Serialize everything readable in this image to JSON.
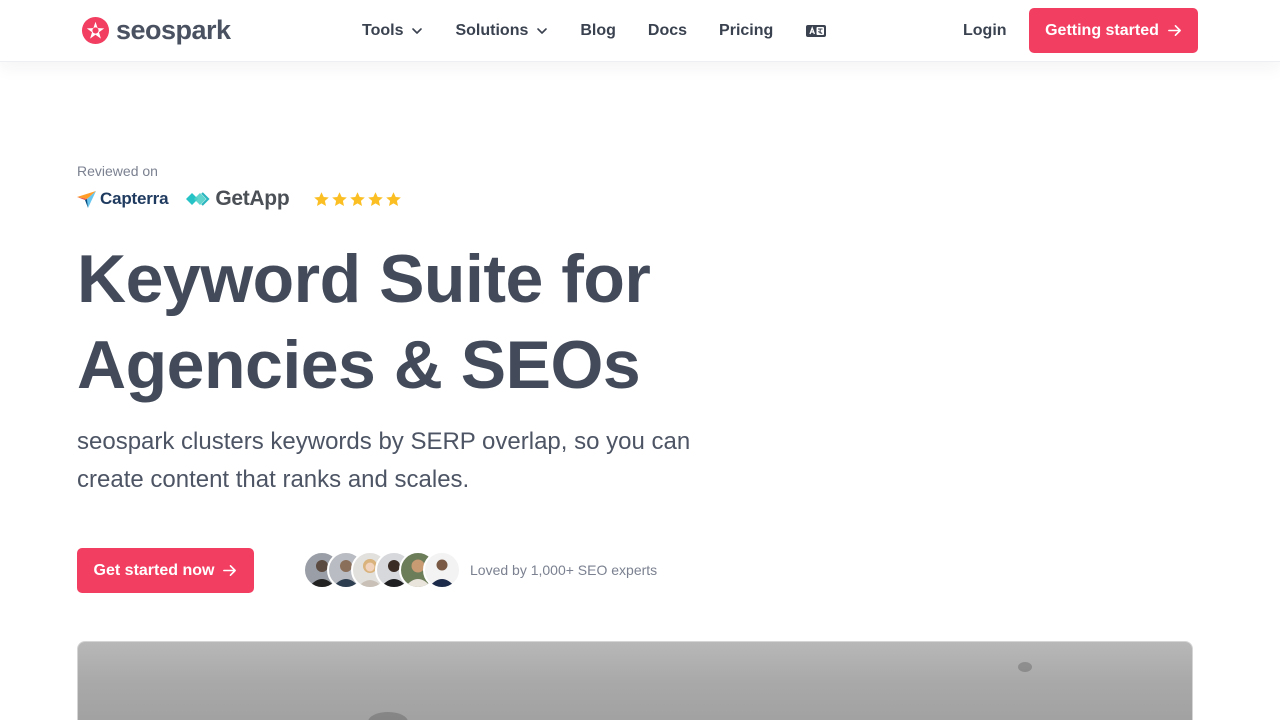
{
  "brand": {
    "name": "seospark",
    "accent": "#f23e61"
  },
  "nav": {
    "items": [
      {
        "label": "Tools",
        "dropdown": true
      },
      {
        "label": "Solutions",
        "dropdown": true
      },
      {
        "label": "Blog",
        "dropdown": false
      },
      {
        "label": "Docs",
        "dropdown": false
      },
      {
        "label": "Pricing",
        "dropdown": false
      }
    ],
    "language_icon": "language-icon",
    "login_label": "Login",
    "cta_label": "Getting started"
  },
  "reviews": {
    "label": "Reviewed on",
    "capterra": "Capterra",
    "getapp": "GetApp",
    "rating": 5,
    "star_color": "#fbbf24"
  },
  "hero": {
    "headline_line1": "Keyword Suite for",
    "headline_line2": "Agencies & SEOs",
    "subtext": "seospark clusters keywords by SERP overlap, so you can create content that ranks and scales.",
    "cta_label": "Get started now",
    "social_proof": "Loved by 1,000+ SEO experts",
    "avatar_count": 6
  }
}
